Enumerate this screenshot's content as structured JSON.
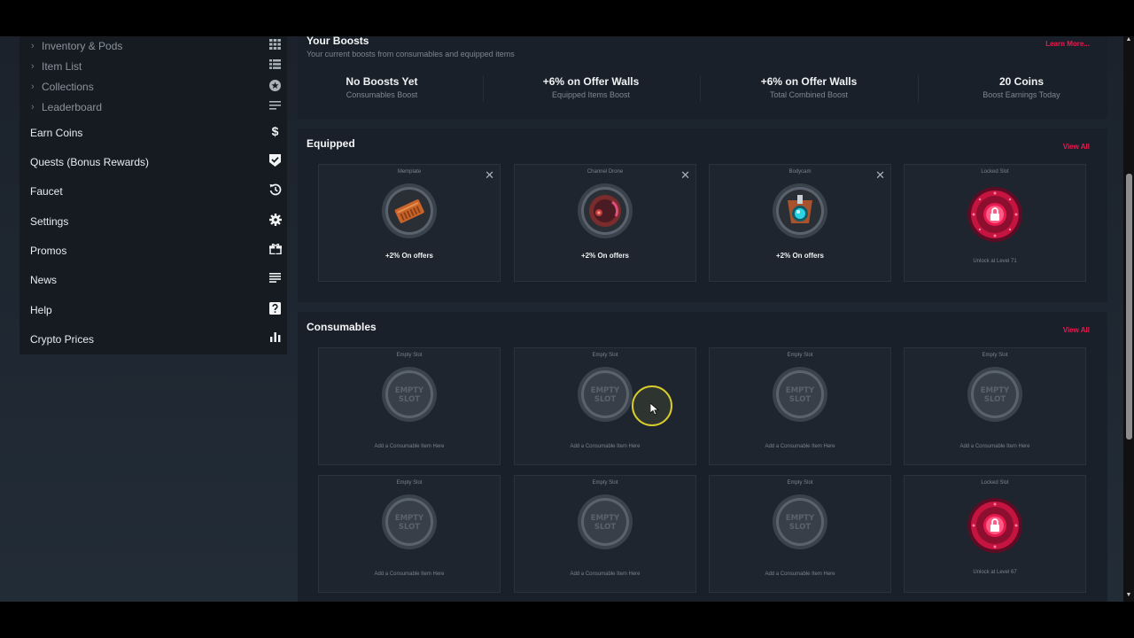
{
  "sidebar": {
    "sub_items": [
      {
        "label": "Inventory & Pods",
        "icon": "grid-icon"
      },
      {
        "label": "Item List",
        "icon": "list-icon"
      },
      {
        "label": "Collections",
        "icon": "star-circle-icon"
      },
      {
        "label": "Leaderboard",
        "icon": "lines-icon"
      }
    ],
    "items": [
      {
        "label": "Earn Coins",
        "icon": "dollar-icon"
      },
      {
        "label": "Quests (Bonus Rewards)",
        "icon": "shield-check-icon"
      },
      {
        "label": "Faucet",
        "icon": "history-icon"
      },
      {
        "label": "Settings",
        "icon": "gear-icon"
      },
      {
        "label": "Promos",
        "icon": "gift-icon"
      },
      {
        "label": "News",
        "icon": "news-lines-icon"
      },
      {
        "label": "Help",
        "icon": "question-icon"
      },
      {
        "label": "Crypto Prices",
        "icon": "bar-chart-icon"
      }
    ]
  },
  "boosts": {
    "title": "Your Boosts",
    "subtitle": "Your current boosts from consumables and equipped items",
    "learn_more": "Learn More...",
    "stats": [
      {
        "value": "No Boosts Yet",
        "label": "Consumables Boost"
      },
      {
        "value": "+6% on Offer Walls",
        "label": "Equipped Items Boost"
      },
      {
        "value": "+6% on Offer Walls",
        "label": "Total Combined Boost"
      },
      {
        "value": "20 Coins",
        "label": "Boost Earnings Today"
      }
    ]
  },
  "equipped": {
    "title": "Equipped",
    "view_all": "View All",
    "cards": [
      {
        "name": "Memplate",
        "bonus": "+2% On offers",
        "icon": "memplate-icon",
        "color": "#c8642a"
      },
      {
        "name": "Channel Drone",
        "bonus": "+2% On offers",
        "icon": "drone-icon",
        "color": "#b03a3a"
      },
      {
        "name": "Bodycam",
        "bonus": "+2% On offers",
        "icon": "bodycam-icon",
        "color": "#2ad4e6"
      },
      {
        "name": "Locked Slot",
        "hint": "Unlock at Level 71",
        "icon": "lock-icon",
        "color": "#e8194f"
      }
    ]
  },
  "consumables": {
    "title": "Consumables",
    "view_all": "View All",
    "empty_text": "EMPTY SLOT",
    "cards": [
      {
        "name": "Empty Slot",
        "hint": "Add a Consumable Item Here"
      },
      {
        "name": "Empty Slot",
        "hint": "Add a Consumable Item Here"
      },
      {
        "name": "Empty Slot",
        "hint": "Add a Consumable Item Here"
      },
      {
        "name": "Empty Slot",
        "hint": "Add a Consumable Item Here"
      },
      {
        "name": "Empty Slot",
        "hint": "Add a Consumable Item Here"
      },
      {
        "name": "Empty Slot",
        "hint": "Add a Consumable Item Here"
      },
      {
        "name": "Empty Slot",
        "hint": "Add a Consumable Item Here"
      },
      {
        "name": "Locked Slot",
        "hint": "Unlock at Level 67"
      }
    ]
  },
  "colors": {
    "accent": "#e8194f",
    "panel": "#1a2029",
    "card": "#1e252e"
  }
}
